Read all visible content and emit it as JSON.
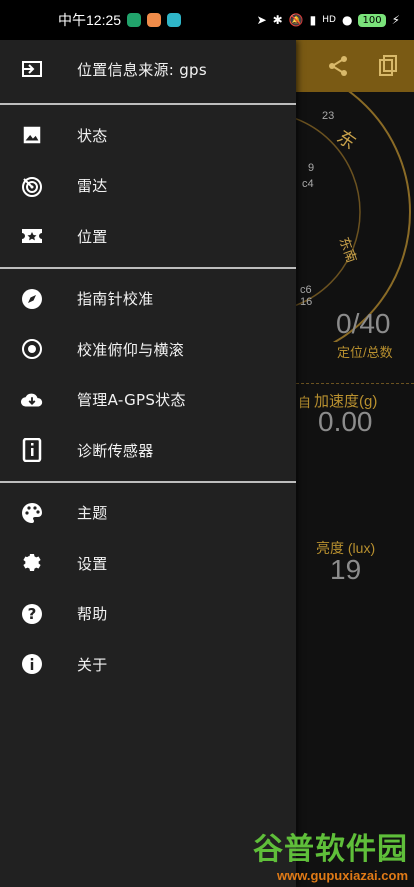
{
  "status_bar": {
    "time": "中午12:25",
    "network": "HD",
    "battery": "100"
  },
  "background": {
    "count": "0/40",
    "count_label": "定位/总数",
    "accel_label": "加速度(g)",
    "accel_value": "0.00",
    "accel_left_label": "自",
    "lux_label": "亮度 (lux)",
    "lux_value": "19",
    "compass_east": "东",
    "compass_southeast": "东南",
    "sats": [
      "23",
      "9",
      "c4",
      "c6",
      "16"
    ],
    "colors": {
      "toolbar": "#7a5a14",
      "accent": "#c9a24a"
    }
  },
  "drawer": {
    "header": {
      "label": "位置信息来源: gps",
      "icon": "input-source-icon"
    },
    "group1": [
      {
        "label": "状态",
        "icon": "image-icon"
      },
      {
        "label": "雷达",
        "icon": "radar-icon"
      },
      {
        "label": "位置",
        "icon": "star-ticket-icon"
      }
    ],
    "group2": [
      {
        "label": "指南针校准",
        "icon": "compass-icon"
      },
      {
        "label": "校准俯仰与横滚",
        "icon": "target-icon"
      },
      {
        "label": "管理A-GPS状态",
        "icon": "cloud-download-icon"
      },
      {
        "label": "诊断传感器",
        "icon": "info-box-icon"
      }
    ],
    "group3": [
      {
        "label": "主题",
        "icon": "palette-icon"
      },
      {
        "label": "设置",
        "icon": "gear-icon"
      },
      {
        "label": "帮助",
        "icon": "help-icon"
      },
      {
        "label": "关于",
        "icon": "info-icon"
      }
    ]
  },
  "watermark": {
    "cn": "谷普软件园",
    "en": "www.gupuxiazai.com"
  }
}
